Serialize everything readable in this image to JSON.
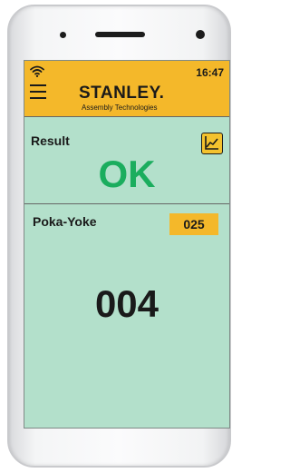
{
  "status_bar": {
    "time": "16:47",
    "wifi_icon": "wifi-icon"
  },
  "header": {
    "menu_icon": "hamburger-menu-icon",
    "brand": "STANLEY.",
    "brand_subtitle": "Assembly Technologies",
    "accent_color": "#f4b82a"
  },
  "result": {
    "label": "Result",
    "value": "OK",
    "value_color": "#1bad5e",
    "chart_icon": "line-chart-icon"
  },
  "poka_yoke": {
    "label": "Poka-Yoke",
    "badge": "025",
    "count": "004"
  },
  "screen_background": "#b3e0cb"
}
